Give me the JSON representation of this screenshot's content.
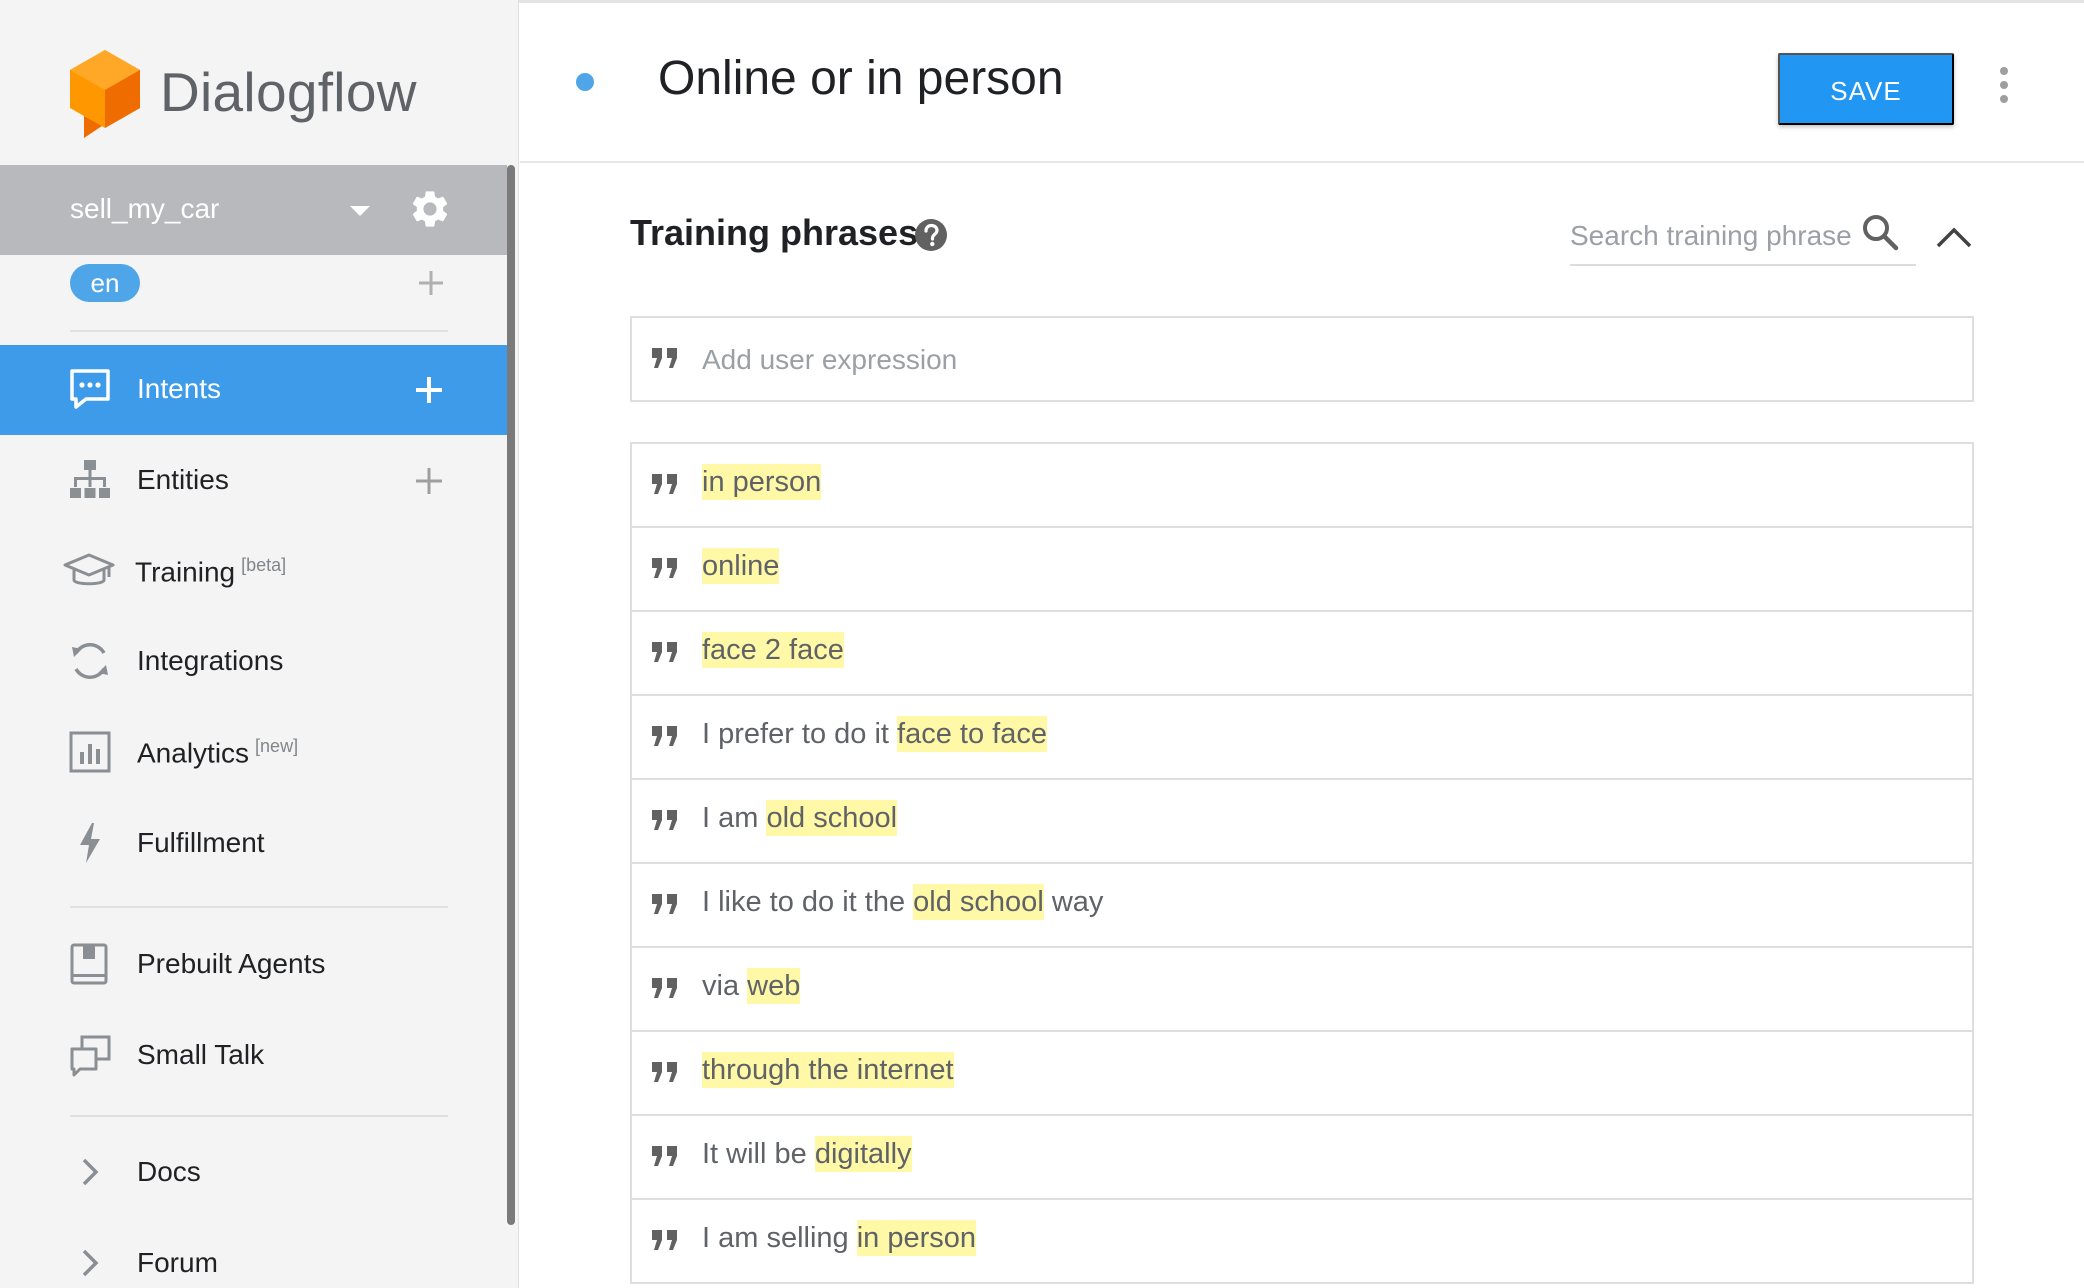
{
  "app": {
    "name": "Dialogflow",
    "agent_name": "sell_my_car",
    "language": "en"
  },
  "sidebar": {
    "items": [
      {
        "id": "intents",
        "label": "Intents",
        "icon": "chat-bubble-icon",
        "active": true
      },
      {
        "id": "entities",
        "label": "Entities",
        "icon": "sitemap-icon"
      },
      {
        "id": "training",
        "label": "Training",
        "badge": "[beta]",
        "icon": "graduation-cap-icon"
      },
      {
        "id": "integrations",
        "label": "Integrations",
        "icon": "sync-icon"
      },
      {
        "id": "analytics",
        "label": "Analytics",
        "badge": "[new]",
        "icon": "bar-chart-icon"
      },
      {
        "id": "fulfillment",
        "label": "Fulfillment",
        "icon": "bolt-icon"
      },
      {
        "id": "prebuilt",
        "label": "Prebuilt Agents",
        "icon": "book-icon"
      },
      {
        "id": "smalltalk",
        "label": "Small Talk",
        "icon": "chat-squares-icon"
      },
      {
        "id": "docs",
        "label": "Docs",
        "icon": "chevron-right-icon"
      },
      {
        "id": "forum",
        "label": "Forum",
        "icon": "chevron-right-icon"
      }
    ]
  },
  "header": {
    "intent_title": "Online or in person",
    "save_label": "SAVE"
  },
  "training": {
    "title": "Training phrases",
    "search_placeholder": "Search training phrase",
    "add_placeholder": "Add user expression",
    "phrases": [
      [
        {
          "t": "in person",
          "h": true
        }
      ],
      [
        {
          "t": "online",
          "h": true
        }
      ],
      [
        {
          "t": "face 2 face",
          "h": true
        }
      ],
      [
        {
          "t": "I prefer to do it ",
          "h": false
        },
        {
          "t": "face to face",
          "h": true
        }
      ],
      [
        {
          "t": "I am ",
          "h": false
        },
        {
          "t": "old school",
          "h": true
        }
      ],
      [
        {
          "t": "I like to do it the ",
          "h": false
        },
        {
          "t": "old school",
          "h": true
        },
        {
          "t": " way",
          "h": false
        }
      ],
      [
        {
          "t": "via ",
          "h": false
        },
        {
          "t": "web",
          "h": true
        }
      ],
      [
        {
          "t": "through the internet",
          "h": true
        }
      ],
      [
        {
          "t": "It will be ",
          "h": false
        },
        {
          "t": "digitally",
          "h": true
        }
      ],
      [
        {
          "t": "I am selling ",
          "h": false
        },
        {
          "t": "in person",
          "h": true
        }
      ]
    ]
  },
  "colors": {
    "accent": "#2196f3",
    "active_nav": "#3d9be9",
    "highlight": "#fff8a6",
    "logo_orange": "#f58220"
  }
}
